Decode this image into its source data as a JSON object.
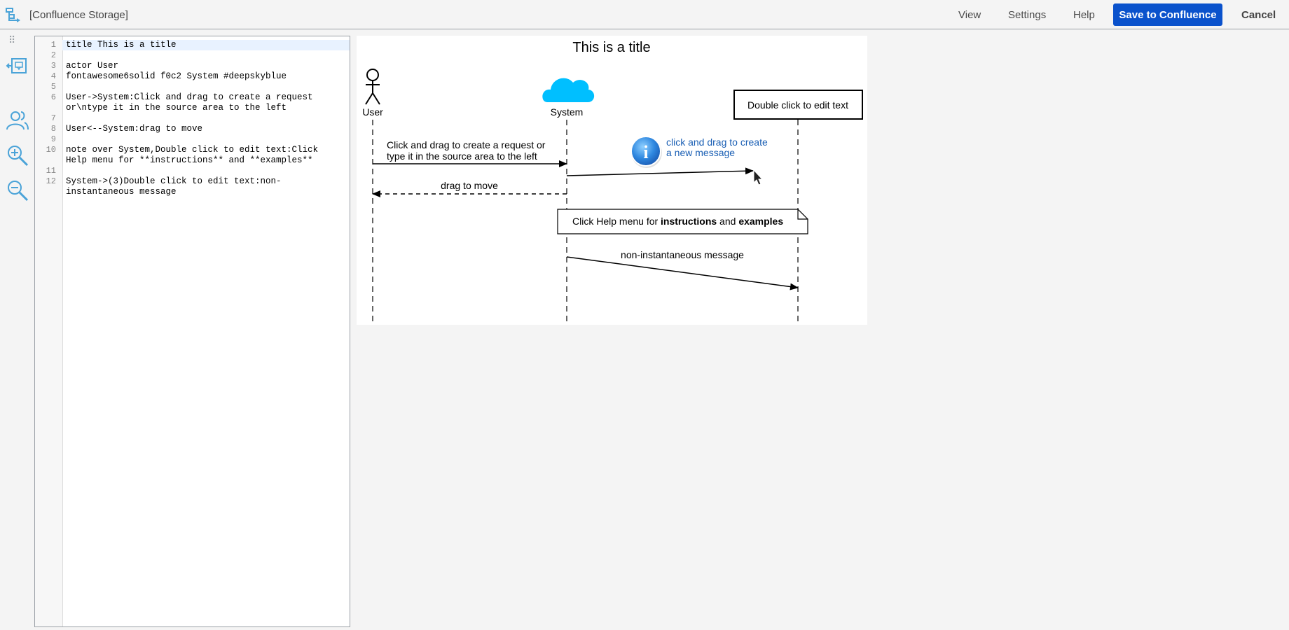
{
  "header": {
    "title": "[Confluence Storage]",
    "nav": {
      "view": "View",
      "settings": "Settings",
      "help": "Help"
    },
    "save_label": "Save to Confluence",
    "cancel_label": "Cancel"
  },
  "colors": {
    "accent": "#0a52cc",
    "icon": "#4aa3d8",
    "cloud": "#00bfff",
    "hint_text": "#1a5fb4"
  },
  "rail": {
    "icons": [
      "drag-handle-icon",
      "insert-message-icon",
      "participants-icon",
      "zoom-in-icon",
      "zoom-out-icon"
    ]
  },
  "editor": {
    "lines": [
      {
        "n": "1",
        "text": "title This is a title"
      },
      {
        "n": "2",
        "text": ""
      },
      {
        "n": "3",
        "text": "actor User"
      },
      {
        "n": "4",
        "text": "fontawesome6solid f0c2 System #deepskyblue"
      },
      {
        "n": "5",
        "text": ""
      },
      {
        "n": "6",
        "text": "User->System:Click and drag to create a request"
      },
      {
        "n": "",
        "text": "or\\ntype it in the source area to the left"
      },
      {
        "n": "7",
        "text": ""
      },
      {
        "n": "8",
        "text": "User<--System:drag to move"
      },
      {
        "n": "9",
        "text": ""
      },
      {
        "n": "10",
        "text": "note over System,Double click to edit text:Click"
      },
      {
        "n": "",
        "text": "Help menu for **instructions** and **examples**"
      },
      {
        "n": "11",
        "text": ""
      },
      {
        "n": "12",
        "text": "System->(3)Double click to edit text:non-"
      },
      {
        "n": "",
        "text": "instantaneous message"
      }
    ]
  },
  "diagram": {
    "title": "This is a title",
    "participants": {
      "user": "User",
      "system": "System",
      "box": "Double click to edit text"
    },
    "messages": {
      "m1_line1": "Click and drag to create a request or",
      "m1_line2": "type it in the source area to the left",
      "m2": "drag to move",
      "m4": "non-instantaneous message"
    },
    "hint": {
      "line1": "click and drag to create",
      "line2": "a new message"
    },
    "note": {
      "prefix": "Click Help menu for ",
      "bold1": "instructions",
      "middle": " and ",
      "bold2": "examples"
    }
  }
}
